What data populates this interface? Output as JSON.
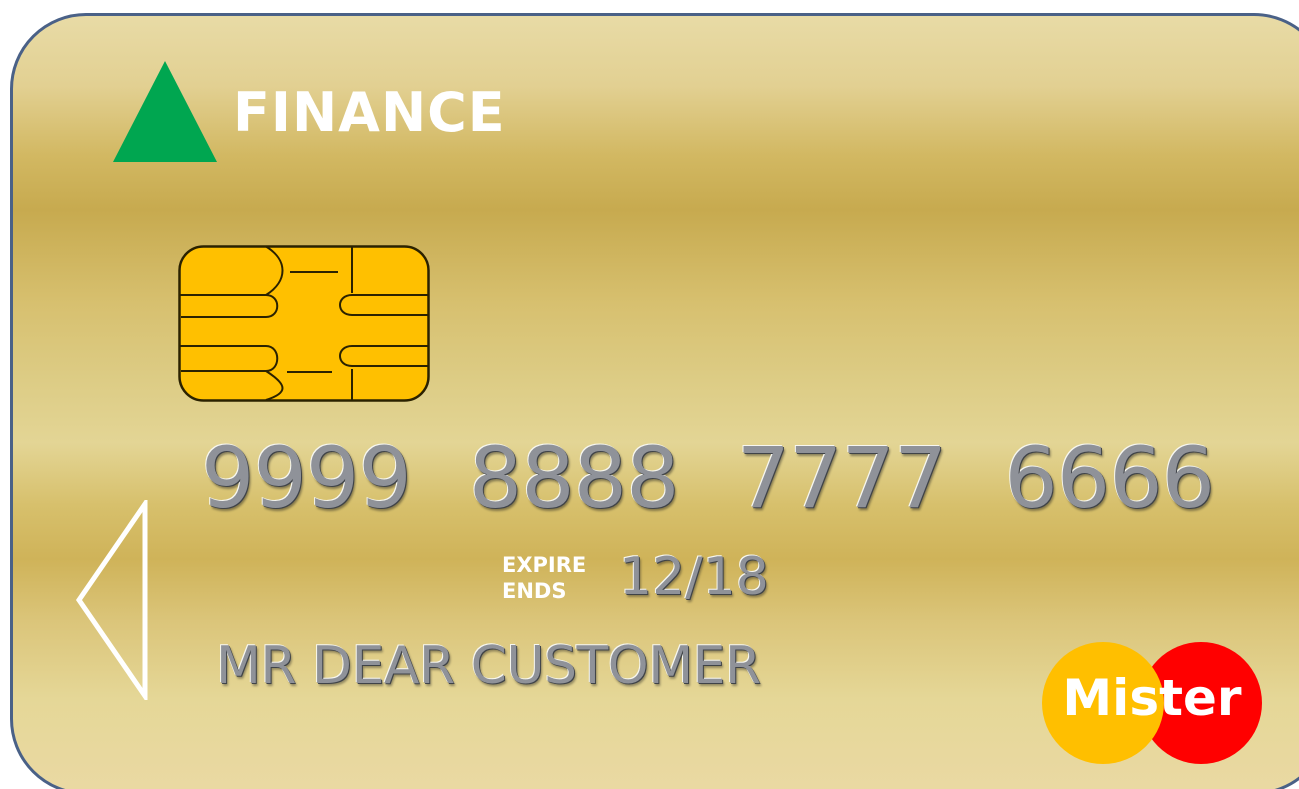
{
  "brand": {
    "name": "FINANCE",
    "icon": "green-triangle-icon",
    "color": "#00a650"
  },
  "card": {
    "number_groups": [
      "9999",
      "8888",
      "7777",
      "6666"
    ],
    "expire_label_top": "EXPIRE",
    "expire_label_bottom": "ENDS",
    "expiry": "12/18",
    "holder": "MR DEAR CUSTOMER"
  },
  "network": {
    "name": "Mister",
    "left_color": "#ffbf00",
    "right_color": "#ff0000"
  },
  "colors": {
    "card_gold": "#d6bd67",
    "chip_gold": "#ffc000",
    "border": "#4a6187"
  }
}
